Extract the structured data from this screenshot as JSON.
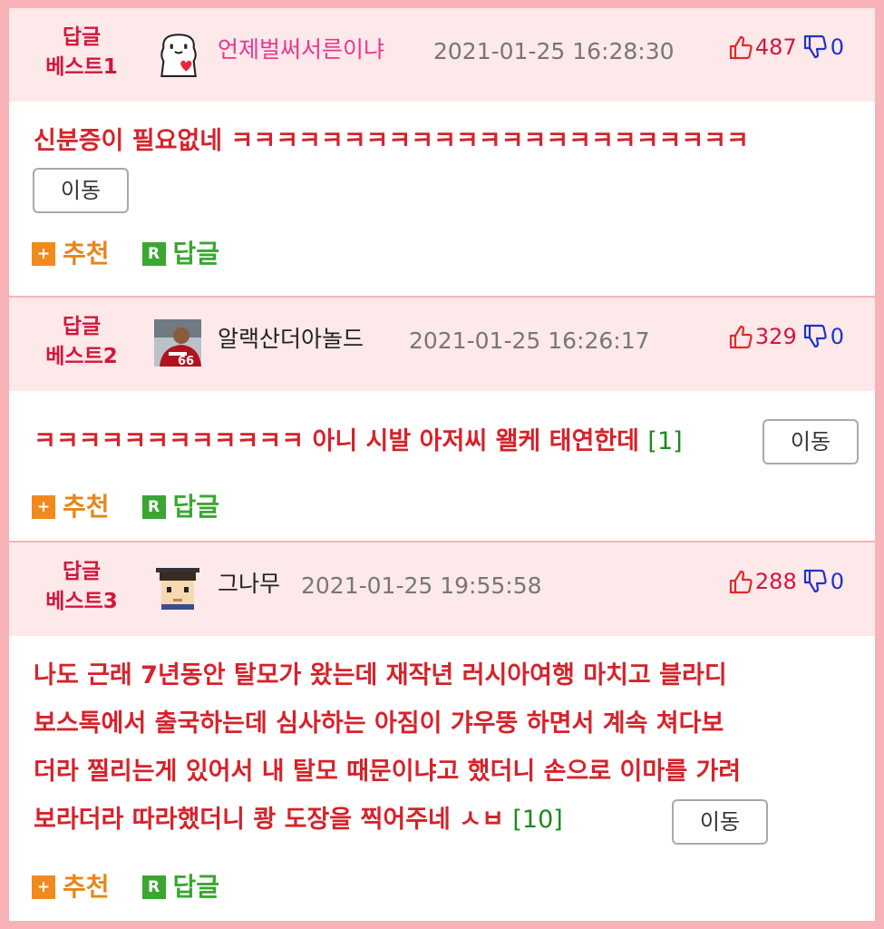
{
  "comments": [
    {
      "best_line1": "답글",
      "best_line2": "베스트1",
      "nickname": "언제벌써서른이냐",
      "nickname_color": "#e8368f",
      "date": "2021-01-25 16:28:30",
      "likes": "487",
      "dislikes": "0",
      "text": "신분증이 필요없네 ㅋㅋㅋㅋㅋㅋㅋㅋㅋㅋㅋㅋㅋㅋㅋㅋㅋㅋㅋㅋㅋㅋㅋ",
      "move_label": "이동",
      "recommend_label": "추천",
      "reply_label": "답글",
      "avatar_icon": "white-bear-heart-avatar-icon"
    },
    {
      "best_line1": "답글",
      "best_line2": "베스트2",
      "nickname": "알랙산더아놀드",
      "nickname_color": "#222222",
      "date": "2021-01-25 16:26:17",
      "likes": "329",
      "dislikes": "0",
      "text": "ㅋㅋㅋㅋㅋㅋㅋㅋㅋㅋㅋㅋ 아니 시발 아저씨 왤케 태연한데",
      "reply_count": "[1]",
      "move_label": "이동",
      "recommend_label": "추천",
      "reply_label": "답글",
      "avatar_icon": "football-player-photo-avatar-icon"
    },
    {
      "best_line1": "답글",
      "best_line2": "베스트3",
      "nickname": "그나무",
      "nickname_color": "#222222",
      "date": "2021-01-25 19:55:58",
      "likes": "288",
      "dislikes": "0",
      "text_lines": [
        "나도 근래 7년동안 탈모가 왔는데 재작년 러시아여행 마치고 블라디",
        "보스톡에서 출국하는데 심사하는 아짐이 갸우뚱 하면서 계속 쳐다보",
        "더라 찔리는게 있어서 내 탈모 때문이냐고 했더니 손으로 이마를 가려",
        "보라더라 따라했더니 쾅 도장을 찍어주네 ㅅㅂ"
      ],
      "reply_count": "[10]",
      "move_label": "이동",
      "recommend_label": "추천",
      "reply_label": "답글",
      "avatar_icon": "graduate-boy-avatar-icon"
    }
  ],
  "colors": {
    "border_pink": "#f7b3b8",
    "header_bg": "#fde8ea",
    "best_red": "#d1173b",
    "text_red": "#d6222a",
    "like_red": "#d1173b",
    "dislike_blue": "#1f32c9",
    "recommend_orange": "#f18a1e",
    "reply_green": "#3ba631"
  }
}
